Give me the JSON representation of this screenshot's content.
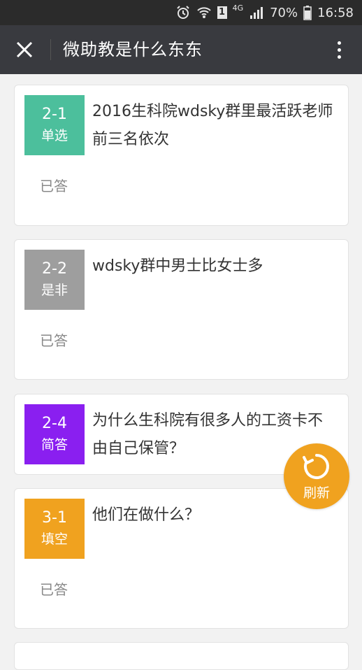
{
  "status_bar": {
    "network": "4G",
    "sim_slot": "1",
    "battery": "70%",
    "time": "16:58"
  },
  "header": {
    "title": "微助教是什么东东"
  },
  "questions": [
    {
      "id": "2-1",
      "type": "单选",
      "text": "2016生科院wdsky群里最活跃老师前三名依次",
      "status": "已答",
      "color": "#4cbf9c"
    },
    {
      "id": "2-2",
      "type": "是非",
      "text": "wdsky群中男士比女士多",
      "status": "已答",
      "color": "#9e9e9e"
    },
    {
      "id": "2-4",
      "type": "简答",
      "text": "为什么生科院有很多人的工资卡不由自己保管？",
      "status": "",
      "color": "#8a1ff0"
    },
    {
      "id": "3-1",
      "type": "填空",
      "text": "他们在做什么？",
      "status": "已答",
      "color": "#f0a21f"
    }
  ],
  "refresh": {
    "label": "刷新",
    "color": "#f0a21f"
  },
  "icons": [
    "alarm-icon",
    "wifi-icon",
    "signal-icon",
    "battery-icon",
    "close-icon",
    "more-vertical-icon",
    "refresh-icon"
  ]
}
